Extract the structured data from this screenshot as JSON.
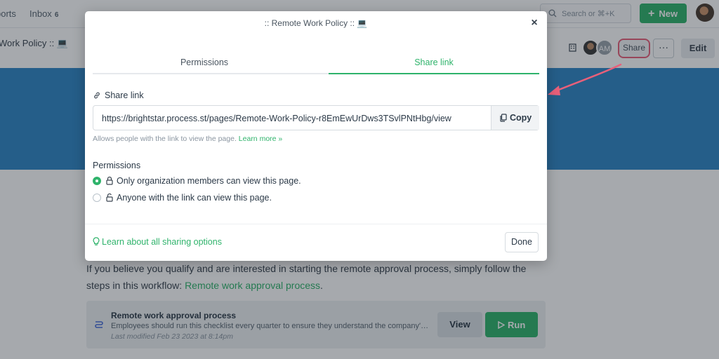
{
  "topbar": {
    "reports_label": "ports",
    "inbox_label": "Inbox",
    "inbox_count": "6",
    "search_placeholder": "Search or ⌘+K",
    "new_button": "New",
    "new_plus": "+"
  },
  "subbar": {
    "page_title": "Work Policy :: 💻",
    "avatar_initials": "AM",
    "share_button": "Share",
    "more_button": "···",
    "edit_button": "Edit"
  },
  "page": {
    "body_text": "If you believe you qualify and are interested in starting the remote approval process, simply follow the steps in this workflow: ",
    "body_link": "Remote work approval process",
    "body_end": ".",
    "workflow": {
      "title": "Remote work approval process",
      "description": "Employees should run this checklist every quarter to ensure they understand the company's…",
      "modified": "Last modified Feb 23 2023 at 8:14pm",
      "view_button": "View",
      "run_button": "Run"
    }
  },
  "modal": {
    "title": ":: Remote Work Policy :: 💻",
    "close": "×",
    "tabs": [
      {
        "label": "Permissions",
        "active": false
      },
      {
        "label": "Share link",
        "active": true
      }
    ],
    "share_link_label": "Share link",
    "url": "https://brightstar.process.st/pages/Remote-Work-Policy-r8EmEwUrDws3TSvlPNtHbg/view",
    "copy_button": "Copy",
    "help_text": "Allows people with the link to view the page.",
    "learn_more": "Learn more »",
    "permissions_label": "Permissions",
    "options": [
      {
        "label": "Only organization members can view this page.",
        "selected": true
      },
      {
        "label": "Anyone with the link can view this page.",
        "selected": false
      }
    ],
    "footer_link": "Learn about all sharing options",
    "done_button": "Done"
  },
  "colors": {
    "accent_green": "#2fb36b",
    "banner_blue": "#2f86c6",
    "annotation_pink": "#e8607a"
  }
}
